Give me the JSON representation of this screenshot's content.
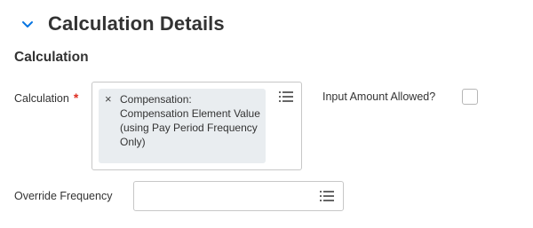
{
  "section": {
    "title": "Calculation Details",
    "expanded": true
  },
  "subsection": {
    "title": "Calculation"
  },
  "calculation_field": {
    "label": "Calculation",
    "required": true,
    "required_marker": "*",
    "selected_item": {
      "remove_glyph": "×",
      "text": "Compensation: Compensation Element Value (using Pay Period Frequency Only)"
    },
    "icon": "list-icon"
  },
  "input_amount_allowed": {
    "label": "Input Amount Allowed?",
    "checked": false
  },
  "override_frequency": {
    "label": "Override Frequency",
    "value": "",
    "icon": "list-icon"
  },
  "colors": {
    "accent": "#0875e1",
    "required": "#de2e21",
    "pill_background": "#e9edf0",
    "border": "#c7c7c7"
  }
}
